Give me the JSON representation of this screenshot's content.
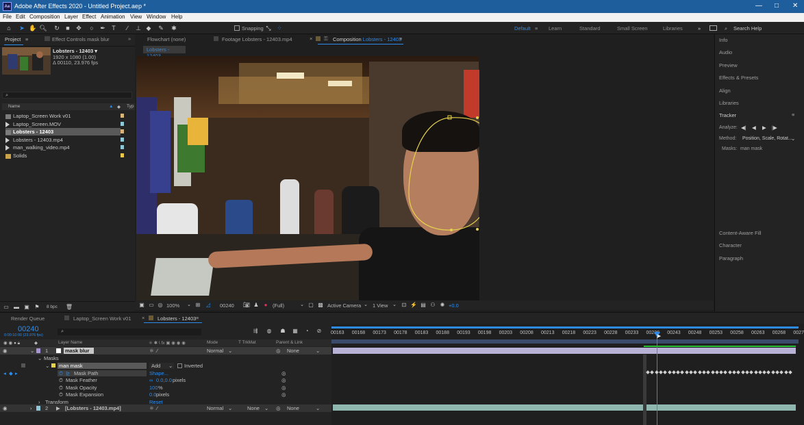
{
  "titlebar": {
    "title": "Adobe After Effects 2020 - Untitled Project.aep *",
    "logo": "Ae",
    "minimize": "—",
    "maximize": "□",
    "close": "✕"
  },
  "menu": [
    "File",
    "Edit",
    "Composition",
    "Layer",
    "Effect",
    "Animation",
    "View",
    "Window",
    "Help"
  ],
  "toolbar": {
    "snapping": "Snapping",
    "workspaces": [
      "Default",
      "Learn",
      "Standard",
      "Small Screen",
      "Libraries"
    ],
    "search_placeholder": "Search Help"
  },
  "project": {
    "tab_project": "Project",
    "tab_effects": "Effect Controls mask blur",
    "comp_name": "Lobsters - 12403 ▾",
    "comp_res": "1920 x 1080 (1.00)",
    "comp_dur": "Δ 00110, 23.976 fps",
    "col_name": "Name",
    "col_type": "Typ",
    "bpc": "8 bpc",
    "items": [
      {
        "name": "Laptop_Screen Work v01",
        "kind": "comp",
        "color": "#d6b47a"
      },
      {
        "name": "Laptop_Screen.MOV",
        "kind": "mov",
        "color": "#8fc7d6"
      },
      {
        "name": "Lobsters - 12403",
        "kind": "comp",
        "color": "#d6b47a",
        "selected": true
      },
      {
        "name": "Lobsters - 12403.mp4",
        "kind": "mov",
        "color": "#8fc7d6"
      },
      {
        "name": "man_walking_video.mp4",
        "kind": "mov",
        "color": "#8fc7d6"
      },
      {
        "name": "Solids",
        "kind": "folder",
        "color": "#e8c84c"
      }
    ]
  },
  "viewer": {
    "tab_flowchart": "Flowchart (none)",
    "tab_footage": "Footage Lobsters - 12403.mp4",
    "tab_comp_prefix": "Composition",
    "tab_comp_name": "Lobsters - 12403",
    "comp_chip": "Lobsters - 12403",
    "zoom": "100%",
    "timecode": "00240",
    "resolution": "(Full)",
    "camera": "Active Camera",
    "views": "1 View",
    "exposure": "+0.0"
  },
  "right_panels": {
    "items": [
      "Info",
      "Audio",
      "Preview",
      "Effects & Presets",
      "Align",
      "Libraries",
      "Tracker"
    ],
    "tracker": {
      "analyze": "Analyze:",
      "method_label": "Method:",
      "method_value": "Position, Scale, Rotat...",
      "masks_label": "Masks:",
      "masks_value": "man mask"
    },
    "lower": [
      "Content-Aware Fill",
      "Character",
      "Paragraph"
    ]
  },
  "timeline": {
    "tab_render": "Render Queue",
    "tab_laptop": "Laptop_Screen Work v01",
    "tab_lobsters": "Lobsters - 12403",
    "timecode": "00240",
    "timecode_sub": "0:00:10:00 (23.976 fps)",
    "headers": {
      "layer_name": "Layer Name",
      "mode": "Mode",
      "trkmat": "T TrkMat",
      "parent": "Parent & Link"
    },
    "ruler": [
      "00163",
      "00168",
      "00173",
      "00178",
      "00183",
      "00188",
      "00193",
      "00198",
      "00203",
      "00208",
      "00213",
      "00218",
      "00223",
      "00228",
      "00233",
      "00238",
      "00243",
      "00248",
      "00253",
      "00258",
      "00263",
      "00268",
      "0027"
    ],
    "layer1": {
      "num": "1",
      "name": "mask blur",
      "mode": "Normal",
      "parent": "None"
    },
    "masks_label": "Masks",
    "mask_name": "man mask",
    "mask_mode": "Add",
    "mask_inverted": "Inverted",
    "props": [
      {
        "name": "Mask Path",
        "value": "Shape...",
        "unit": ""
      },
      {
        "name": "Mask Feather",
        "value": "0.0,0.0",
        "unit": " pixels"
      },
      {
        "name": "Mask Opacity",
        "value": "100",
        "unit": "%"
      },
      {
        "name": "Mask Expansion",
        "value": "0.0",
        "unit": " pixels"
      }
    ],
    "transform": "Transform",
    "transform_reset": "Reset",
    "layer2": {
      "num": "2",
      "name": "[Lobsters - 12403.mp4]",
      "mode": "Normal",
      "trkmat": "None",
      "parent": "None"
    }
  }
}
